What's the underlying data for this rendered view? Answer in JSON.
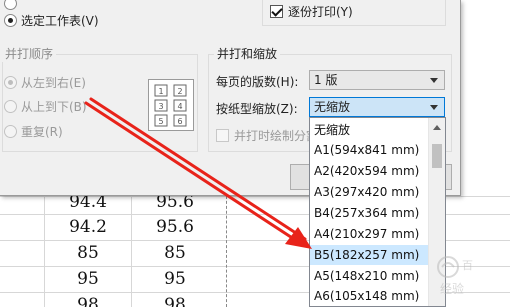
{
  "sheet": {
    "rows": [
      {
        "a": "94.4",
        "b": "95.6"
      },
      {
        "a": "94.2",
        "b": "95.6"
      },
      {
        "a": "85",
        "b": "85"
      },
      {
        "a": "95",
        "b": "95"
      },
      {
        "a": "98",
        "b": "98"
      }
    ]
  },
  "dialog": {
    "print_range": {
      "opt_partial_top": "",
      "opt_selected_sheet": "选定工作表(V)"
    },
    "collate_label": "逐份打印(Y)",
    "collate_checked": true,
    "print_order": {
      "title": "并打顺序",
      "options": [
        "从左到右(E)",
        "从上到下(B)",
        "重复(R)"
      ],
      "page_digits": [
        "1",
        "2",
        "3",
        "4",
        "5",
        "6"
      ]
    },
    "scaling": {
      "title": "并打和缩放",
      "pages_per_sheet_label": "每页的版数(H):",
      "pages_per_sheet_value": "1 版",
      "scale_to_paper_label": "按纸型缩放(Z):",
      "scale_to_paper_value": "无缩放",
      "draw_border_label": "并打时绘制分割"
    }
  },
  "dropdown": {
    "options": [
      "无缩放",
      "A1(594x841 mm)",
      "A2(420x594 mm)",
      "A3(297x420 mm)",
      "B4(257x364 mm)",
      "A4(210x297 mm)",
      "B5(182x257 mm)",
      "A5(148x210 mm)",
      "A6(105x148 mm)"
    ],
    "selected_index": 6
  },
  "annotation": {
    "arrow_color": "#e8231a"
  },
  "colors": {
    "accent": "#0078d7",
    "selection": "#cce8ff",
    "dialog_bg": "#f0f0f0"
  }
}
